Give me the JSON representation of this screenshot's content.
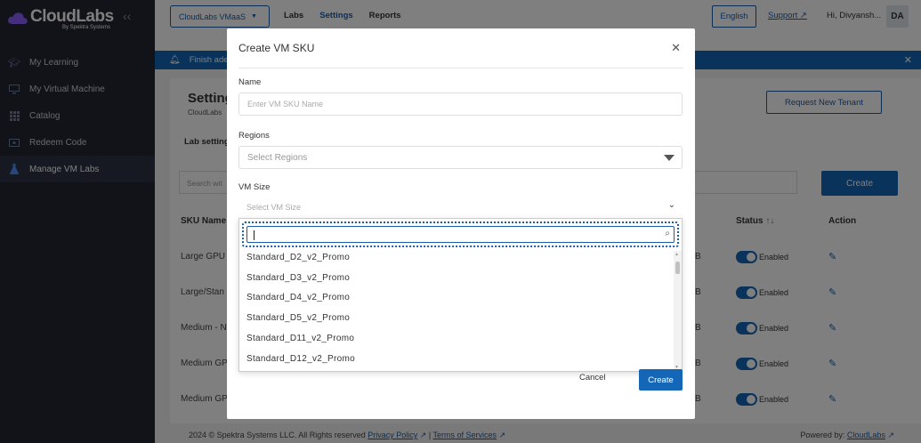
{
  "sidebar": {
    "logo_text": "CloudLabs",
    "logo_sub": "By Spektra Systems",
    "items": [
      {
        "label": "My Learning",
        "icon": "graduation-cap-icon"
      },
      {
        "label": "My Virtual Machine",
        "icon": "monitor-icon"
      },
      {
        "label": "Catalog",
        "icon": "grid-icon"
      },
      {
        "label": "Redeem Code",
        "icon": "ticket-icon"
      },
      {
        "label": "Manage VM Labs",
        "icon": "flask-icon",
        "active": true
      }
    ]
  },
  "header": {
    "tenant": "CloudLabs VMaaS",
    "nav": [
      "Labs",
      "Settings",
      "Reports"
    ],
    "active_nav": "Settings",
    "language": "English",
    "support": "Support",
    "user": "Hi, Divyansh...",
    "avatar": "DA"
  },
  "notification": {
    "text": "Finish ade"
  },
  "page": {
    "title": "Setting",
    "subtitle": "CloudLabs",
    "request_button": "Request New Tenant",
    "section": "Lab setting",
    "search_placeholder": "Search wit",
    "create_button": "Create",
    "columns": {
      "sku_name": "SKU Name",
      "status": "Status",
      "action": "Action"
    },
    "rows": [
      {
        "name": "Large GPU",
        "mem": "B",
        "status": "Enabled"
      },
      {
        "name": "Large/Stan",
        "mem": "B",
        "status": "Enabled"
      },
      {
        "name": "Medium - N",
        "mem": "B",
        "status": "Enabled"
      },
      {
        "name": "Medium GP",
        "mem": "B",
        "status": "Enabled"
      },
      {
        "name": "Medium GP",
        "mem": "B",
        "status": "Enabled"
      }
    ]
  },
  "footer": {
    "copyright": "2024 © Spektra Systems LLC. All Rights reserved",
    "privacy": "Privacy Policy",
    "separator": "|",
    "terms": "Terms of Services",
    "powered_prefix": "Powered by:",
    "powered_link": "CloudLabs"
  },
  "modal": {
    "title": "Create VM SKU",
    "name_label": "Name",
    "name_placeholder": "Enter VM SKU Name",
    "regions_label": "Regions",
    "regions_placeholder": "Select Regions",
    "vmsize_label": "VM Size",
    "vmsize_placeholder": "Select VM Size",
    "search_value": "",
    "options": [
      "Standard_D2_v2_Promo",
      "Standard_D3_v2_Promo",
      "Standard_D4_v2_Promo",
      "Standard_D5_v2_Promo",
      "Standard_D11_v2_Promo",
      "Standard_D12_v2_Promo"
    ],
    "cancel": "Cancel",
    "create": "Create"
  },
  "colors": {
    "brand": "#1466b6",
    "sidebar": "#222633",
    "overlay": "rgba(0,0,0,0.5)"
  }
}
